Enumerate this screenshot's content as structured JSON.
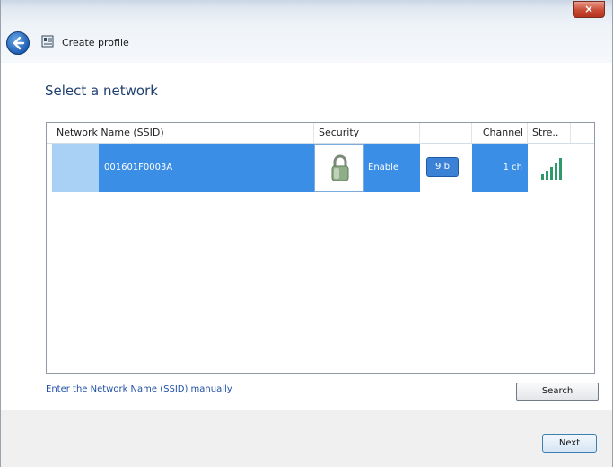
{
  "window": {
    "close_label": "×",
    "header_title": "Create profile",
    "back_icon": "back-arrow-icon",
    "header_icon": "profile-card-icon"
  },
  "main": {
    "heading": "Select a network",
    "columns": [
      "Network Name (SSID)",
      "Security",
      "",
      "Channel",
      "Stre.."
    ],
    "networks": [
      {
        "ssid": "001601F0003A",
        "security_icon": "lock-icon",
        "security": "Enable",
        "band": "9 b",
        "channel": "1 ch",
        "signal_icon": "signal-strength-icon"
      }
    ],
    "manual_link": "Enter the Network Name (SSID) manually",
    "search_label": "Search"
  },
  "footer": {
    "next_label": "Next"
  },
  "colors": {
    "selection": "#3b8ee6",
    "accent": "#1e3f6f"
  }
}
